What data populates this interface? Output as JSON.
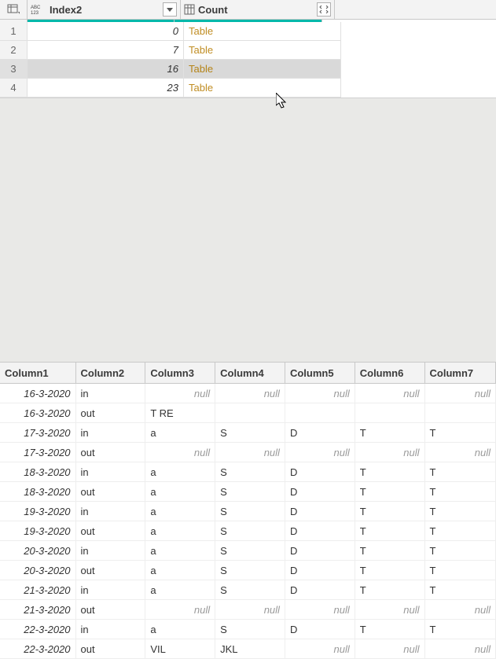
{
  "top_grid": {
    "columns": {
      "index2": {
        "label": "Index2",
        "type_icon": "abc123-icon"
      },
      "count": {
        "label": "Count",
        "type_icon": "table-icon"
      }
    },
    "rows": [
      {
        "n": "1",
        "index2": "0",
        "count": "Table",
        "selected": false
      },
      {
        "n": "2",
        "index2": "7",
        "count": "Table",
        "selected": false
      },
      {
        "n": "3",
        "index2": "16",
        "count": "Table",
        "selected": true
      },
      {
        "n": "4",
        "index2": "23",
        "count": "Table",
        "selected": false
      }
    ]
  },
  "null_text": "null",
  "bottom_grid": {
    "columns": [
      "Column1",
      "Column2",
      "Column3",
      "Column4",
      "Column5",
      "Column6",
      "Column7"
    ],
    "rows": [
      {
        "c1": "16-3-2020",
        "c2": "in",
        "c3": null,
        "c4": null,
        "c5": null,
        "c6": null,
        "c7": null
      },
      {
        "c1": "16-3-2020",
        "c2": "out",
        "c3": "T RE",
        "c4": "",
        "c5": "",
        "c6": "",
        "c7": ""
      },
      {
        "c1": "17-3-2020",
        "c2": "in",
        "c3": "a",
        "c4": "S",
        "c5": "D",
        "c6": "T",
        "c7": "T"
      },
      {
        "c1": "17-3-2020",
        "c2": "out",
        "c3": null,
        "c4": null,
        "c5": null,
        "c6": null,
        "c7": null
      },
      {
        "c1": "18-3-2020",
        "c2": "in",
        "c3": "a",
        "c4": "S",
        "c5": "D",
        "c6": "T",
        "c7": "T"
      },
      {
        "c1": "18-3-2020",
        "c2": "out",
        "c3": "a",
        "c4": "S",
        "c5": "D",
        "c6": "T",
        "c7": "T"
      },
      {
        "c1": "19-3-2020",
        "c2": "in",
        "c3": "a",
        "c4": "S",
        "c5": "D",
        "c6": "T",
        "c7": "T"
      },
      {
        "c1": "19-3-2020",
        "c2": "out",
        "c3": "a",
        "c4": "S",
        "c5": "D",
        "c6": "T",
        "c7": "T"
      },
      {
        "c1": "20-3-2020",
        "c2": "in",
        "c3": "a",
        "c4": "S",
        "c5": "D",
        "c6": "T",
        "c7": "T"
      },
      {
        "c1": "20-3-2020",
        "c2": "out",
        "c3": "a",
        "c4": "S",
        "c5": "D",
        "c6": "T",
        "c7": "T"
      },
      {
        "c1": "21-3-2020",
        "c2": "in",
        "c3": "a",
        "c4": "S",
        "c5": "D",
        "c6": "T",
        "c7": "T"
      },
      {
        "c1": "21-3-2020",
        "c2": "out",
        "c3": null,
        "c4": null,
        "c5": null,
        "c6": null,
        "c7": null
      },
      {
        "c1": "22-3-2020",
        "c2": "in",
        "c3": "a",
        "c4": "S",
        "c5": "D",
        "c6": "T",
        "c7": "T"
      },
      {
        "c1": "22-3-2020",
        "c2": "out",
        "c3": "VIL",
        "c4": "JKL",
        "c5": null,
        "c6": null,
        "c7": null
      }
    ]
  }
}
